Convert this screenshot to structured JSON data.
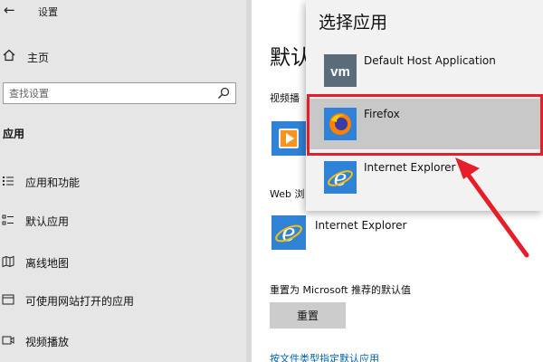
{
  "settings": {
    "window_title": "设置",
    "home_label": "主页",
    "search_placeholder": "查找设置",
    "section_label": "应用",
    "nav_items": [
      {
        "label": "应用和功能",
        "icon": "apps-features-icon"
      },
      {
        "label": "默认应用",
        "icon": "default-apps-icon"
      },
      {
        "label": "离线地图",
        "icon": "offline-maps-icon"
      },
      {
        "label": "可使用网站打开的应用",
        "icon": "apps-for-websites-icon"
      },
      {
        "label": "视频播放",
        "icon": "video-playback-icon"
      }
    ]
  },
  "main": {
    "title_partial": "默认",
    "video_label_partial": "视频播",
    "web_label_partial": "Web 浏",
    "current_browser": "Internet Explorer",
    "reset_label": "重置为 Microsoft 推荐的默认值",
    "reset_button": "重置",
    "file_type_link": "按文件类型指定默认应用"
  },
  "flyout": {
    "title": "选择应用",
    "apps": [
      {
        "name": "Default Host Application",
        "icon": "vm-icon",
        "selected": false
      },
      {
        "name": "Firefox",
        "icon": "firefox-icon",
        "selected": true
      },
      {
        "name": "Internet Explorer",
        "icon": "internet-explorer-icon",
        "selected": false
      }
    ]
  },
  "colors": {
    "sidebar_bg": "#e6e6e6",
    "accent_blue": "#2f82d6",
    "highlight_red": "#e51e2a",
    "link_blue": "#0063b1",
    "selected_row": "#c8c8c8"
  }
}
